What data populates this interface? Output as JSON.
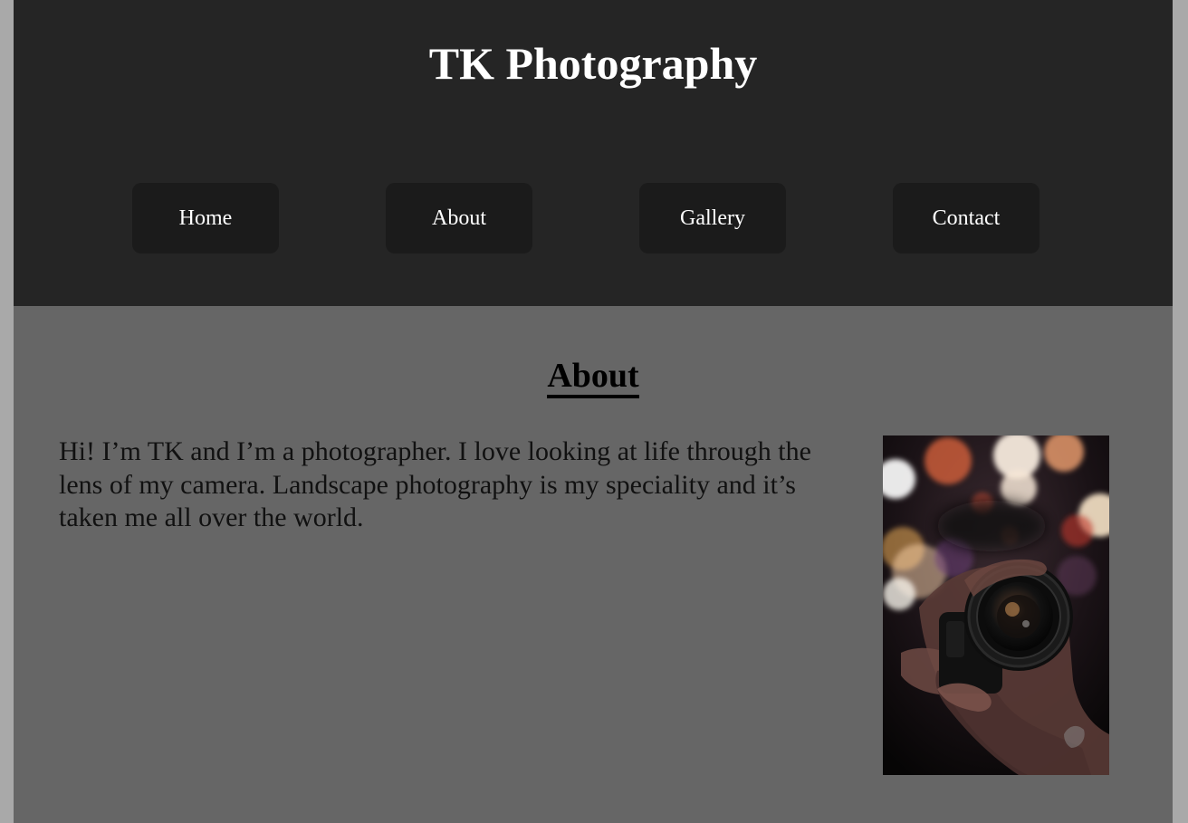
{
  "site": {
    "title": "TK Photography"
  },
  "nav": {
    "items": [
      {
        "label": "Home"
      },
      {
        "label": "About"
      },
      {
        "label": "Gallery"
      },
      {
        "label": "Contact"
      }
    ]
  },
  "about": {
    "heading": "About",
    "text": "Hi! I’m TK and I’m a photographer. I love looking at life through the lens of my camera. Landscape photography is my speciality and it’s taken me all over the world."
  },
  "colors": {
    "header_bg": "#252525",
    "content_bg": "#666666",
    "nav_button_bg": "#1b1b1b",
    "outer_bg": "#a9a9a9"
  }
}
